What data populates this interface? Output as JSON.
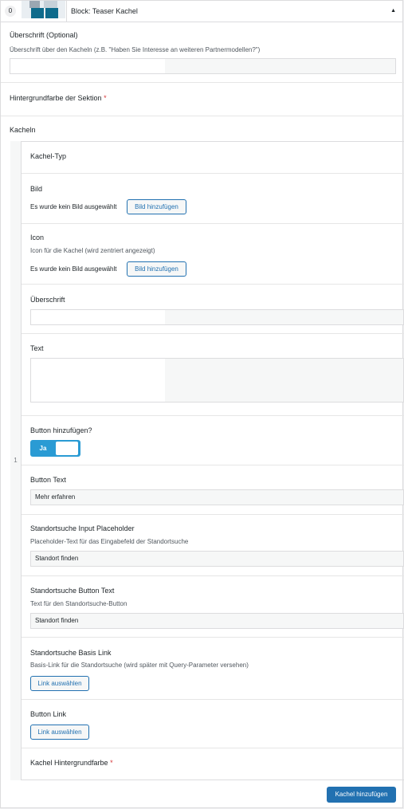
{
  "block": {
    "index": "0",
    "title": "Block: Teaser Kachel",
    "toggle_icon": "caret-up"
  },
  "heading": {
    "label": "Überschrift (Optional)",
    "description": "Überschrift über den Kacheln (z.B. \"Haben Sie Interesse an weiteren Partnermodellen?\")",
    "value": ""
  },
  "background": {
    "label": "Hintergrundfarbe der Sektion",
    "required": "*"
  },
  "tiles": {
    "label": "Kacheln",
    "row_number": "1",
    "tile_type": {
      "label": "Kachel-Typ"
    },
    "image": {
      "label": "Bild",
      "status": "Es wurde kein Bild ausgewählt",
      "button": "Bild hinzufügen"
    },
    "icon": {
      "label": "Icon",
      "description": "Icon für die Kachel (wird zentriert angezeigt)",
      "status": "Es wurde kein Bild ausgewählt",
      "button": "Bild hinzufügen"
    },
    "title": {
      "label": "Überschrift",
      "value": ""
    },
    "text": {
      "label": "Text",
      "value": ""
    },
    "add_button": {
      "label": "Button hinzufügen?",
      "toggle_on": "Ja"
    },
    "button_text": {
      "label": "Button Text",
      "value": "Mehr erfahren"
    },
    "location_placeholder": {
      "label": "Standortsuche Input Placeholder",
      "description": "Placeholder-Text für das Eingabefeld der Standortsuche",
      "value": "Standort finden"
    },
    "location_button": {
      "label": "Standortsuche Button Text",
      "description": "Text für den Standortsuche-Button",
      "value": "Standort finden"
    },
    "location_link": {
      "label": "Standortsuche Basis Link",
      "description": "Basis-Link für die Standortsuche (wird später mit Query-Parameter versehen)",
      "button": "Link auswählen"
    },
    "button_link": {
      "label": "Button Link",
      "button": "Link auswählen"
    },
    "tile_bg": {
      "label": "Kachel Hintergrundfarbe",
      "required": "*"
    },
    "add_tile": "Kachel hinzufügen"
  }
}
